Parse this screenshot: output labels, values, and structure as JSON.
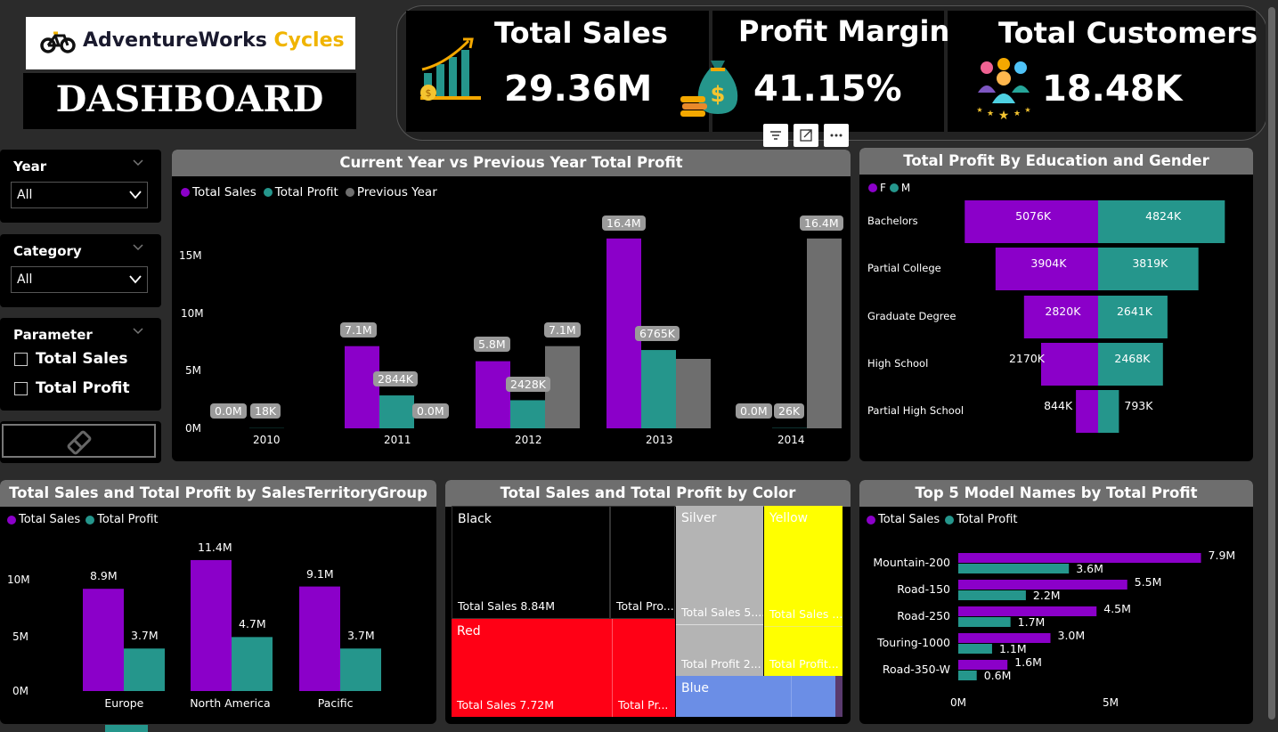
{
  "brand": {
    "name_a": "AdventureWorks",
    "name_b": "Cycles",
    "dashboard": "DASHBOARD"
  },
  "kpis": [
    {
      "title": "Total Sales",
      "value": "29.36M",
      "icon": "growth-chart-icon"
    },
    {
      "title": "Profit Margin",
      "value": "41.15%",
      "icon": "money-bag-icon"
    },
    {
      "title": "Total Customers",
      "value": "18.48K",
      "icon": "customers-icon"
    }
  ],
  "slicers": {
    "year": {
      "title": "Year",
      "value": "All"
    },
    "category": {
      "title": "Category",
      "value": "All"
    },
    "parameter": {
      "title": "Parameter",
      "options": [
        "Total Sales",
        "Total Profit"
      ]
    }
  },
  "colors": {
    "sales": "#8b00c9",
    "profit": "#25968c",
    "previous": "#6e6e6e"
  },
  "charts": {
    "yoy": {
      "title": "Current Year vs Previous Year Total Profit",
      "legend": [
        "Total Sales",
        "Total Profit",
        "Previous Year"
      ],
      "y_ticks": [
        "15M",
        "10M",
        "5M",
        "0M"
      ],
      "categories": [
        "2010",
        "2011",
        "2012",
        "2013",
        "2014"
      ],
      "labels": [
        [
          "0.0M",
          "18K",
          ""
        ],
        [
          "7.1M",
          "2844K",
          "0.0M"
        ],
        [
          "5.8M",
          "2428K",
          "7.1M"
        ],
        [
          "16.4M",
          "6765K",
          ""
        ],
        [
          "0.0M",
          "26K",
          "16.4M"
        ]
      ]
    },
    "education": {
      "title": "Total Profit By Education and Gender",
      "legend": [
        "F",
        "M"
      ],
      "rows": [
        {
          "name": "Bachelors",
          "f": "5076K",
          "m": "4824K"
        },
        {
          "name": "Partial College",
          "f": "3904K",
          "m": "3819K"
        },
        {
          "name": "Graduate Degree",
          "f": "2820K",
          "m": "2641K"
        },
        {
          "name": "High School",
          "f": "2170K",
          "m": "2468K"
        },
        {
          "name": "Partial High School",
          "f": "844K",
          "m": "793K"
        }
      ]
    },
    "territory": {
      "title": "Total Sales and Total Profit by SalesTerritoryGroup",
      "legend": [
        "Total Sales",
        "Total Profit"
      ],
      "y_ticks": [
        "10M",
        "5M",
        "0M"
      ],
      "groups": [
        {
          "name": "Europe",
          "sales": "8.9M",
          "profit": "3.7M"
        },
        {
          "name": "North America",
          "sales": "11.4M",
          "profit": "4.7M"
        },
        {
          "name": "Pacific",
          "sales": "9.1M",
          "profit": "3.7M"
        }
      ]
    },
    "color": {
      "title": "Total Sales and Total Profit by Color",
      "black": {
        "name": "Black",
        "sales": "Total Sales 8.84M",
        "profit": "Total Pro..."
      },
      "red": {
        "name": "Red",
        "sales": "Total Sales 7.72M",
        "profit": "Total Pr..."
      },
      "silver": {
        "name": "Silver",
        "sales": "Total Sales 5....",
        "profit": "Total Profit 2..."
      },
      "yellow": {
        "name": "Yellow",
        "sales": "Total Sales ...",
        "profit": "Total Profit..."
      },
      "blue": {
        "name": "Blue"
      }
    },
    "models": {
      "title": "Top 5 Model Names by Total Profit",
      "legend": [
        "Total Sales",
        "Total Profit"
      ],
      "x_ticks": [
        "0M",
        "5M"
      ],
      "rows": [
        {
          "name": "Mountain-200",
          "sales": "7.9M",
          "profit": "3.6M"
        },
        {
          "name": "Road-150",
          "sales": "5.5M",
          "profit": "2.2M"
        },
        {
          "name": "Road-250",
          "sales": "4.5M",
          "profit": "1.7M"
        },
        {
          "name": "Touring-1000",
          "sales": "3.0M",
          "profit": "1.1M"
        },
        {
          "name": "Road-350-W",
          "sales": "1.6M",
          "profit": "0.6M"
        }
      ]
    }
  },
  "chart_data": [
    {
      "type": "bar",
      "title": "Current Year vs Previous Year Total Profit",
      "categories": [
        "2010",
        "2011",
        "2012",
        "2013",
        "2014"
      ],
      "series": [
        {
          "name": "Total Sales",
          "values": [
            0.0,
            7.1,
            5.8,
            16.4,
            0.0
          ]
        },
        {
          "name": "Total Profit",
          "values": [
            0.018,
            2.844,
            2.428,
            6.765,
            0.026
          ]
        },
        {
          "name": "Previous Year",
          "values": [
            0,
            0.0,
            7.1,
            6.0,
            16.4
          ]
        }
      ],
      "ylim": [
        0,
        17.5
      ]
    },
    {
      "type": "bar",
      "title": "Total Profit By Education and Gender",
      "categories": [
        "Bachelors",
        "Partial College",
        "Graduate Degree",
        "High School",
        "Partial High School"
      ],
      "series": [
        {
          "name": "F",
          "values": [
            5076,
            3904,
            2820,
            2170,
            844
          ]
        },
        {
          "name": "M",
          "values": [
            4824,
            3819,
            2641,
            2468,
            793
          ]
        }
      ]
    },
    {
      "type": "bar",
      "title": "Total Sales and Total Profit by SalesTerritoryGroup",
      "categories": [
        "Europe",
        "North America",
        "Pacific"
      ],
      "series": [
        {
          "name": "Total Sales",
          "values": [
            8.9,
            11.4,
            9.1
          ]
        },
        {
          "name": "Total Profit",
          "values": [
            3.7,
            4.7,
            3.7
          ]
        }
      ],
      "ylim": [
        0,
        12.5
      ]
    },
    {
      "type": "bar",
      "title": "Top 5 Model Names by Total Profit",
      "categories": [
        "Mountain-200",
        "Road-150",
        "Road-250",
        "Touring-1000",
        "Road-350-W"
      ],
      "series": [
        {
          "name": "Total Sales",
          "values": [
            7.9,
            5.5,
            4.5,
            3.0,
            1.6
          ]
        },
        {
          "name": "Total Profit",
          "values": [
            3.6,
            2.2,
            1.7,
            1.1,
            0.6
          ]
        }
      ],
      "xlim": [
        0,
        7.9
      ]
    }
  ]
}
